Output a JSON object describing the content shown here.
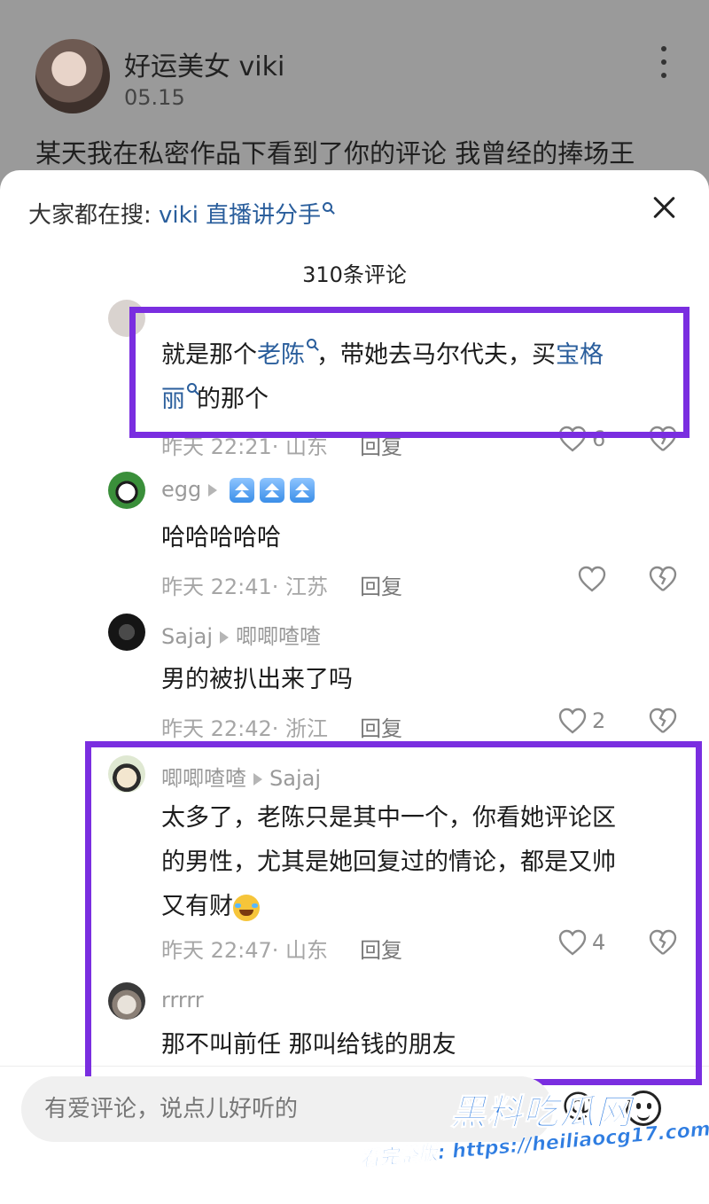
{
  "post": {
    "author": "好运美女 viki",
    "date": "05.15",
    "text": "某天我在私密作品下看到了你的评论 我曾经的捧场王"
  },
  "sheet": {
    "search_prefix": "大家都在搜:",
    "search_term": "viki 直播讲分手",
    "comment_count": "310条评论"
  },
  "comments": [
    {
      "text_parts": [
        "就是那个",
        "老陈",
        "，带她去马尔代夫，买",
        "宝格",
        "丽",
        "的那个"
      ],
      "time_location": "昨天 22:21· 山东",
      "reply": "回复",
      "likes": "6"
    },
    {
      "user": "egg",
      "text": "哈哈哈哈哈",
      "time_location": "昨天 22:41· 江苏",
      "reply": "回复",
      "likes": ""
    },
    {
      "user": "Sajaj",
      "reply_to": "唧唧喳喳",
      "text": "男的被扒出来了吗",
      "time_location": "昨天 22:42· 浙江",
      "reply": "回复",
      "likes": "2"
    },
    {
      "user": "唧唧喳喳",
      "reply_to": "Sajaj",
      "text_line1": "太多了，老陈只是其中一个，你看她评论区",
      "text_line2": "的男性，尤其是她回复过的情论，都是又帅",
      "text_line3": "又有财",
      "time_location": "昨天 22:47· 山东",
      "reply": "回复",
      "likes": "4"
    },
    {
      "user": "rrrrr",
      "text": "那不叫前任  那叫给钱的朋友"
    }
  ],
  "input": {
    "placeholder": "有爱评论，说点儿好听的"
  },
  "watermark": {
    "logo": "黑料吃瓜网",
    "url": "看完整版: https://heiliaocg17.com"
  },
  "colors": {
    "highlight_box": "#7a2ee0",
    "link": "#2a5e9c",
    "badge": "#3b8ee8"
  }
}
